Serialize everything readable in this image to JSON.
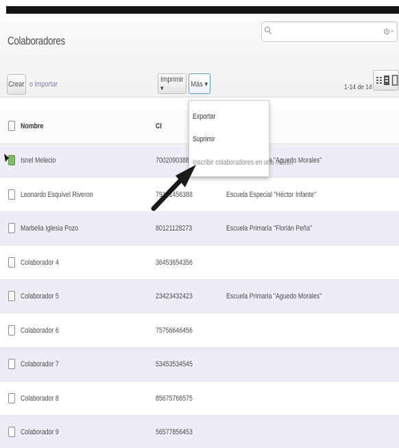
{
  "header": {
    "title": "Colaboradores",
    "search": {
      "value": "",
      "placeholder": ""
    }
  },
  "toolbar": {
    "create_label": "Crear",
    "import_label": "o Importar",
    "print_label": "Imprimir ▾",
    "more_label": "Más ▾",
    "pager": "1-14 de 14"
  },
  "more_menu": {
    "items": [
      "Exportar",
      "Suprimir",
      "Inscribir colaboradores en una misión"
    ]
  },
  "table": {
    "columns": [
      "Nombre",
      "CI"
    ],
    "rows": [
      {
        "checked": true,
        "nombre": "Isnel Melecio",
        "ci": "70020903888",
        "escuela": "Escuela Primaria \"Aguedo Morales\""
      },
      {
        "checked": false,
        "nombre": "Leonardo Esquivel Riveron",
        "ci": "79101456388",
        "escuela": "Escuela Especial \"Héctor Infante\""
      },
      {
        "checked": false,
        "nombre": "Marbelia Iglesia Pozo",
        "ci": "80121128273",
        "escuela": "Escuela Primaria \"Florián Peña\""
      },
      {
        "checked": false,
        "nombre": "Colaborador 4",
        "ci": "36453654356",
        "escuela": ""
      },
      {
        "checked": false,
        "nombre": "Colaborador 5",
        "ci": "23423432423",
        "escuela": "Escuela Primaria \"Aguedo Morales\""
      },
      {
        "checked": false,
        "nombre": "Colaborador 6",
        "ci": "75756646456",
        "escuela": ""
      },
      {
        "checked": false,
        "nombre": "Colaborador 7",
        "ci": "53453534545",
        "escuela": ""
      },
      {
        "checked": false,
        "nombre": "Colaborador 8",
        "ci": "85675766575",
        "escuela": ""
      },
      {
        "checked": false,
        "nombre": "Colaborador 9",
        "ci": "56577856453",
        "escuela": ""
      }
    ]
  },
  "colors": {
    "row_alt": "#ededf6",
    "link": "#7c7bad",
    "checkbox_on": "#7fbf61",
    "active_button_border": "#5b9fd6"
  },
  "icons": {
    "search": "search-icon",
    "search_options": "gear-icon",
    "view_list": "list-view-icon",
    "view_form": "form-view-icon",
    "arrow": "arrow-annotation"
  }
}
